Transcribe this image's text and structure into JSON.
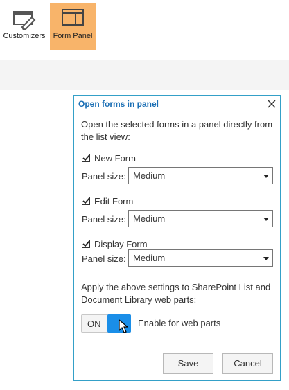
{
  "ribbon": {
    "customizers_label": "Customizers",
    "form_panel_label": "Form Panel",
    "active_color": "#f8b46a"
  },
  "dialog": {
    "title": "Open forms in panel",
    "intro": "Open the selected forms in a panel directly from the list view:",
    "forms": [
      {
        "label": "New Form",
        "checked": true,
        "panel_size_label": "Panel size:",
        "panel_size": "Medium"
      },
      {
        "label": "Edit Form",
        "checked": true,
        "panel_size_label": "Panel size:",
        "panel_size": "Medium"
      },
      {
        "label": "Display Form",
        "checked": true,
        "panel_size_label": "Panel size:",
        "panel_size": "Medium"
      }
    ],
    "apply_text": "Apply the above settings to SharePoint List and Document Library web parts:",
    "toggle": {
      "state_label": "ON",
      "label": "Enable for web parts",
      "on": true,
      "color": "#1a8ee8"
    },
    "save_label": "Save",
    "cancel_label": "Cancel"
  }
}
